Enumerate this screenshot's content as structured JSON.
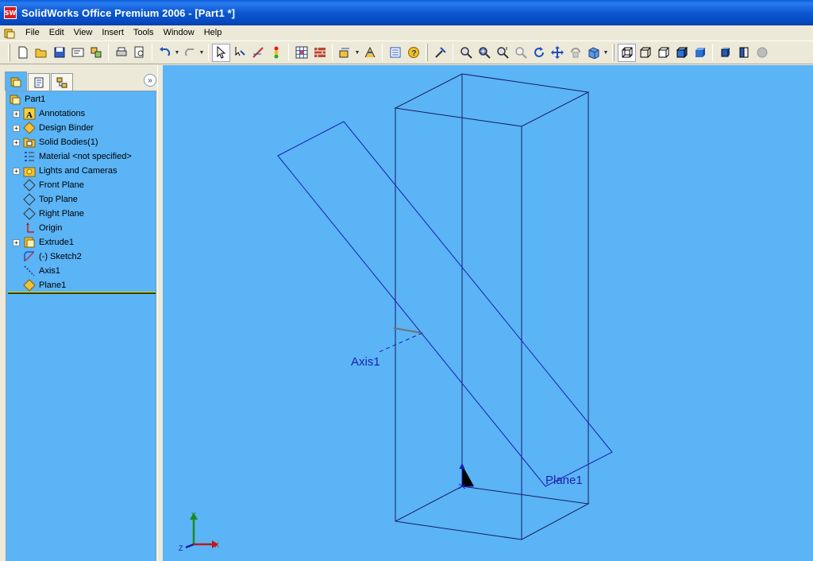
{
  "window": {
    "title": "SolidWorks Office Premium 2006 - [Part1 *]",
    "app_icon_text": "SW"
  },
  "menu": {
    "items": [
      "File",
      "Edit",
      "View",
      "Insert",
      "Tools",
      "Window",
      "Help"
    ]
  },
  "toolbar": {
    "groups": [
      [
        "new-document-icon",
        "open-icon",
        "save-icon",
        "make-drawing-icon",
        "make-assembly-icon"
      ],
      [
        "print-icon",
        "print-preview-icon"
      ],
      [
        "undo-icon",
        "redo-icon"
      ],
      [
        "select-icon",
        "select-other-icon",
        "sketch-icon",
        "rebuild-icon"
      ],
      [
        "options-grid-icon",
        "brick-icon"
      ],
      [
        "dimension-icon",
        "smart-mate-icon"
      ],
      [
        "properties-icon",
        "help-icon"
      ],
      [
        "normal-to-icon",
        "zoom-to-fit-icon",
        "zoom-area-icon",
        "zoom-in-out-icon",
        "zoom-selection-icon",
        "rotate-icon",
        "pan-icon",
        "roll-icon",
        "view-orientation-icon"
      ],
      [
        "wireframe-icon",
        "hidden-lines-visible-icon",
        "hidden-lines-removed-icon",
        "shaded-edges-icon",
        "shaded-icon"
      ],
      [
        "shadows-icon",
        "section-view-icon",
        "realview-icon"
      ]
    ]
  },
  "feature_tree": {
    "root": "Part1",
    "items": [
      {
        "label": "Annotations",
        "expandable": true,
        "icon": "annotations-icon"
      },
      {
        "label": "Design Binder",
        "expandable": true,
        "icon": "design-binder-icon"
      },
      {
        "label": "Solid Bodies(1)",
        "expandable": true,
        "icon": "solid-bodies-icon"
      },
      {
        "label": "Material <not specified>",
        "expandable": false,
        "icon": "material-icon"
      },
      {
        "label": "Lights and Cameras",
        "expandable": true,
        "icon": "lights-icon"
      },
      {
        "label": "Front Plane",
        "expandable": false,
        "icon": "plane-icon"
      },
      {
        "label": "Top Plane",
        "expandable": false,
        "icon": "plane-icon"
      },
      {
        "label": "Right Plane",
        "expandable": false,
        "icon": "plane-icon"
      },
      {
        "label": "Origin",
        "expandable": false,
        "icon": "origin-icon"
      },
      {
        "label": "Extrude1",
        "expandable": true,
        "icon": "extrude-icon"
      },
      {
        "label": "(-) Sketch2",
        "expandable": false,
        "icon": "sketch-icon"
      },
      {
        "label": "Axis1",
        "expandable": false,
        "icon": "axis-icon"
      },
      {
        "label": "Plane1",
        "expandable": false,
        "icon": "plane-selected-icon"
      }
    ]
  },
  "viewport": {
    "labels": {
      "axis": "Axis1",
      "plane": "Plane1"
    },
    "triad": {
      "x": "X",
      "y": "Y",
      "z": "Z"
    },
    "colors": {
      "background": "#5ab4f6",
      "edges": "#1a1a60",
      "plane": "#1c1cb0"
    }
  }
}
